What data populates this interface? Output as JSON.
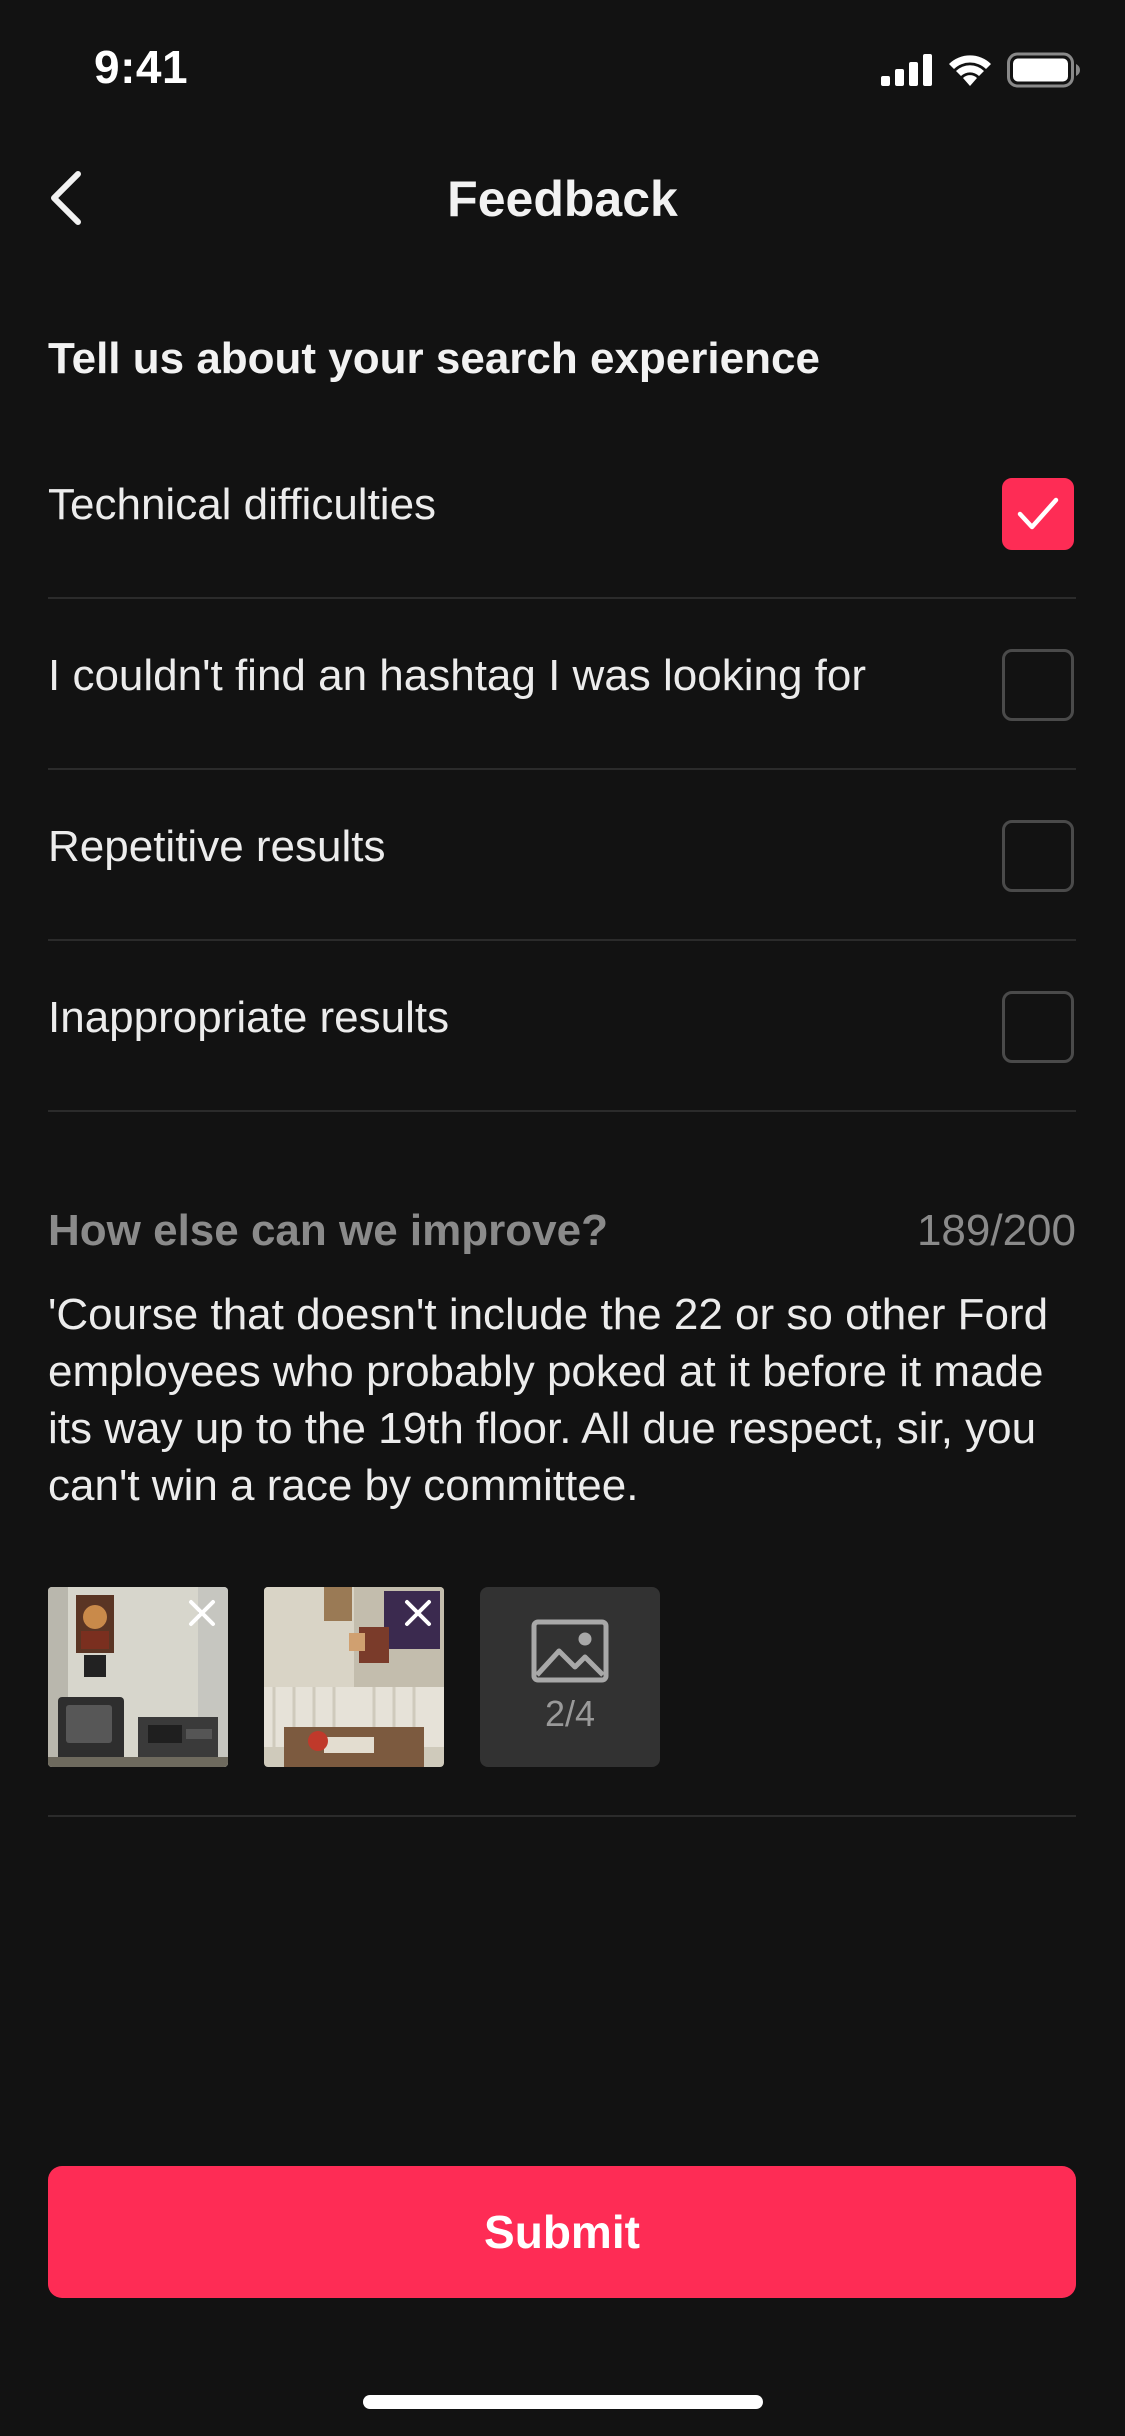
{
  "status_bar": {
    "time": "9:41",
    "icons": [
      "cellular-signal-icon",
      "wifi-icon",
      "battery-icon"
    ]
  },
  "nav": {
    "back_icon": "chevron-left-icon",
    "title": "Feedback"
  },
  "section_heading": "Tell us about your search experience",
  "options": [
    {
      "label": "Technical difficulties",
      "checked": true
    },
    {
      "label": "I couldn't find an hashtag I was looking for",
      "checked": false
    },
    {
      "label": "Repetitive results",
      "checked": false
    },
    {
      "label": "Inappropriate results",
      "checked": false
    }
  ],
  "improve": {
    "label": "How else can we improve?",
    "counter": "189/200",
    "text": "'Course that doesn't include the 22 or so other Ford employees who probably poked at it before it made its way up to the 19th floor. All due respect, sir, you can't win a race by committee."
  },
  "attachments": {
    "photos": [
      {
        "name": "photo-room-tv",
        "remove_icon": "close-icon"
      },
      {
        "name": "photo-room-corner",
        "remove_icon": "close-icon"
      }
    ],
    "add_icon": "image-icon",
    "count": "2/4"
  },
  "submit_label": "Submit",
  "colors": {
    "background": "#121212",
    "accent": "#fe2c55",
    "divider": "#2b2b2b",
    "muted_text": "#8a8a8a",
    "tile": "#323232"
  }
}
